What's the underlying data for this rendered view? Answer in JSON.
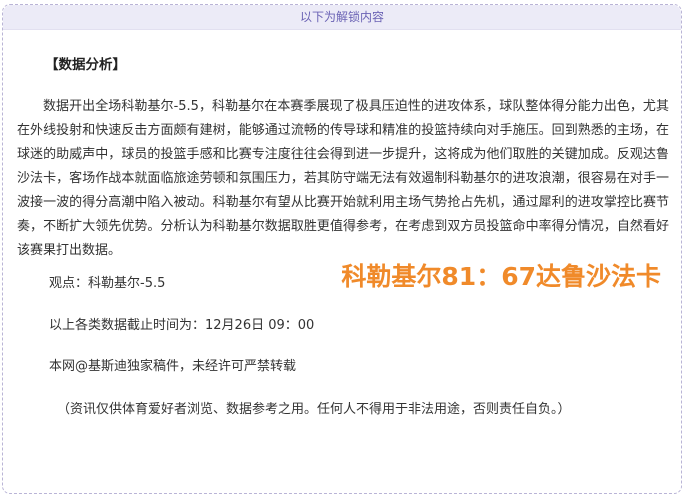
{
  "header": {
    "unlock_label": "以下为解锁内容"
  },
  "article": {
    "section_title": "【数据分析】",
    "analysis_paragraph": "数据开出全场科勒基尔-5.5，科勒基尔在本赛季展现了极具压迫性的进攻体系，球队整体得分能力出色，尤其在外线投射和快速反击方面颇有建树，能够通过流畅的传导球和精准的投篮持续向对手施压。回到熟悉的主场，在球迷的助威声中，球员的投篮手感和比赛专注度往往会得到进一步提升，这将成为他们取胜的关键加成。反观达鲁沙法卡，客场作战本就面临旅途劳顿和氛围压力，若其防守端无法有效遏制科勒基尔的进攻浪潮，很容易在对手一波接一波的得分高潮中陷入被动。科勒基尔有望从比赛开始就利用主场气势抢占先机，通过犀利的进攻掌控比赛节奏，不断扩大领先优势。分析认为科勒基尔数据取胜更值得参考，在考虑到双方员投篮命中率得分情况，自然看好该赛果打出数据。",
    "viewpoint": "观点：科勒基尔-5.5",
    "score": "科勒基尔81：67达鲁沙法卡",
    "cutoff_time": "以上各类数据截止时间为：12月26日 09：00",
    "copyright": "本网@基斯迪独家稿件，未经许可严禁转载",
    "disclaimer": "（资讯仅供体育爱好者浏览、数据参考之用。任何人不得用于非法用途，否则责任自负。）"
  }
}
